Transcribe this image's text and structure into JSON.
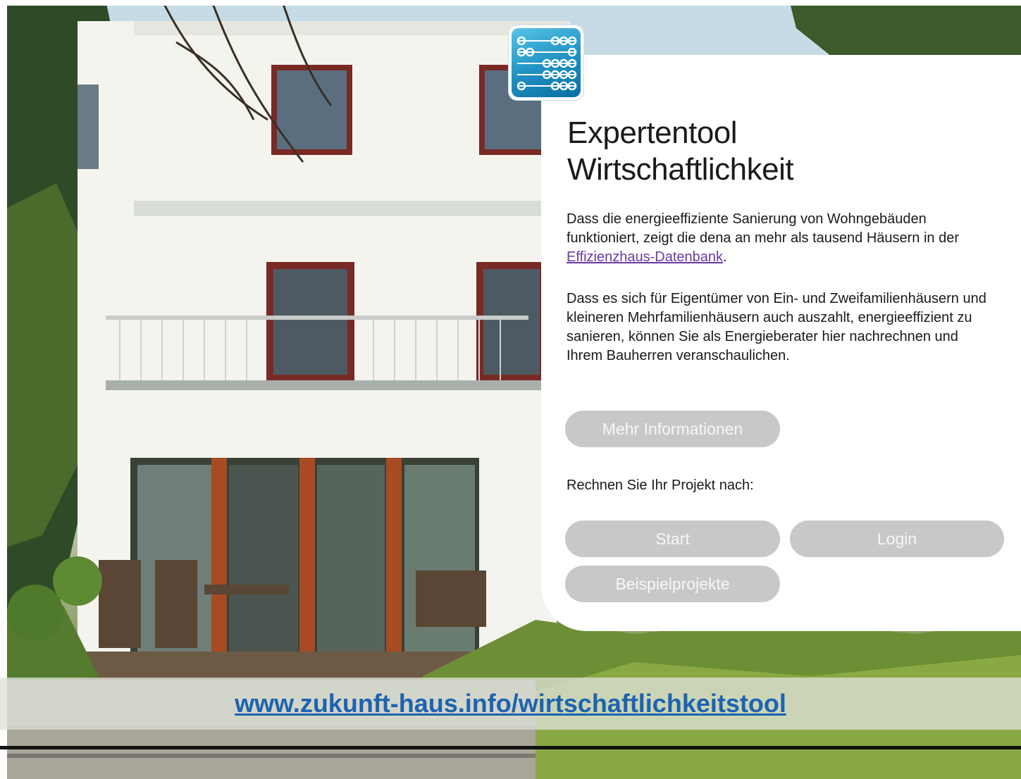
{
  "logo": {
    "icon": "abacus-icon",
    "color": "#1f8fc2"
  },
  "title": {
    "line1": "Expertentool",
    "line2": "Wirtschaftlichkeit"
  },
  "intro": {
    "text_before": "Dass die energieeffiziente Sanierung von Wohngebäuden funktioniert, zeigt die dena an mehr als tausend Häusern in der ",
    "link_text": "Effizienzhaus-Datenbank",
    "text_after": "."
  },
  "body_text": "Dass es sich für Eigentümer von Ein- und Zweifamilienhäusern und kleineren Mehrfamilienhäusern auch auszahlt, energieeffizient zu sanieren, können Sie als Energieberater hier nachrechnen und Ihrem Bauherren veranschaulichen.",
  "buttons": {
    "more_info": "Mehr Informationen",
    "start": "Start",
    "login": "Login",
    "examples": "Beispielprojekte"
  },
  "project_label": "Rechnen Sie Ihr Projekt nach:",
  "url": "www.zukunft-haus.info/wirtschaftlichkeitstool",
  "colors": {
    "button_bg": "#c8c8c8",
    "link_purple": "#6a3aa0",
    "url_blue": "#1d63b0"
  }
}
